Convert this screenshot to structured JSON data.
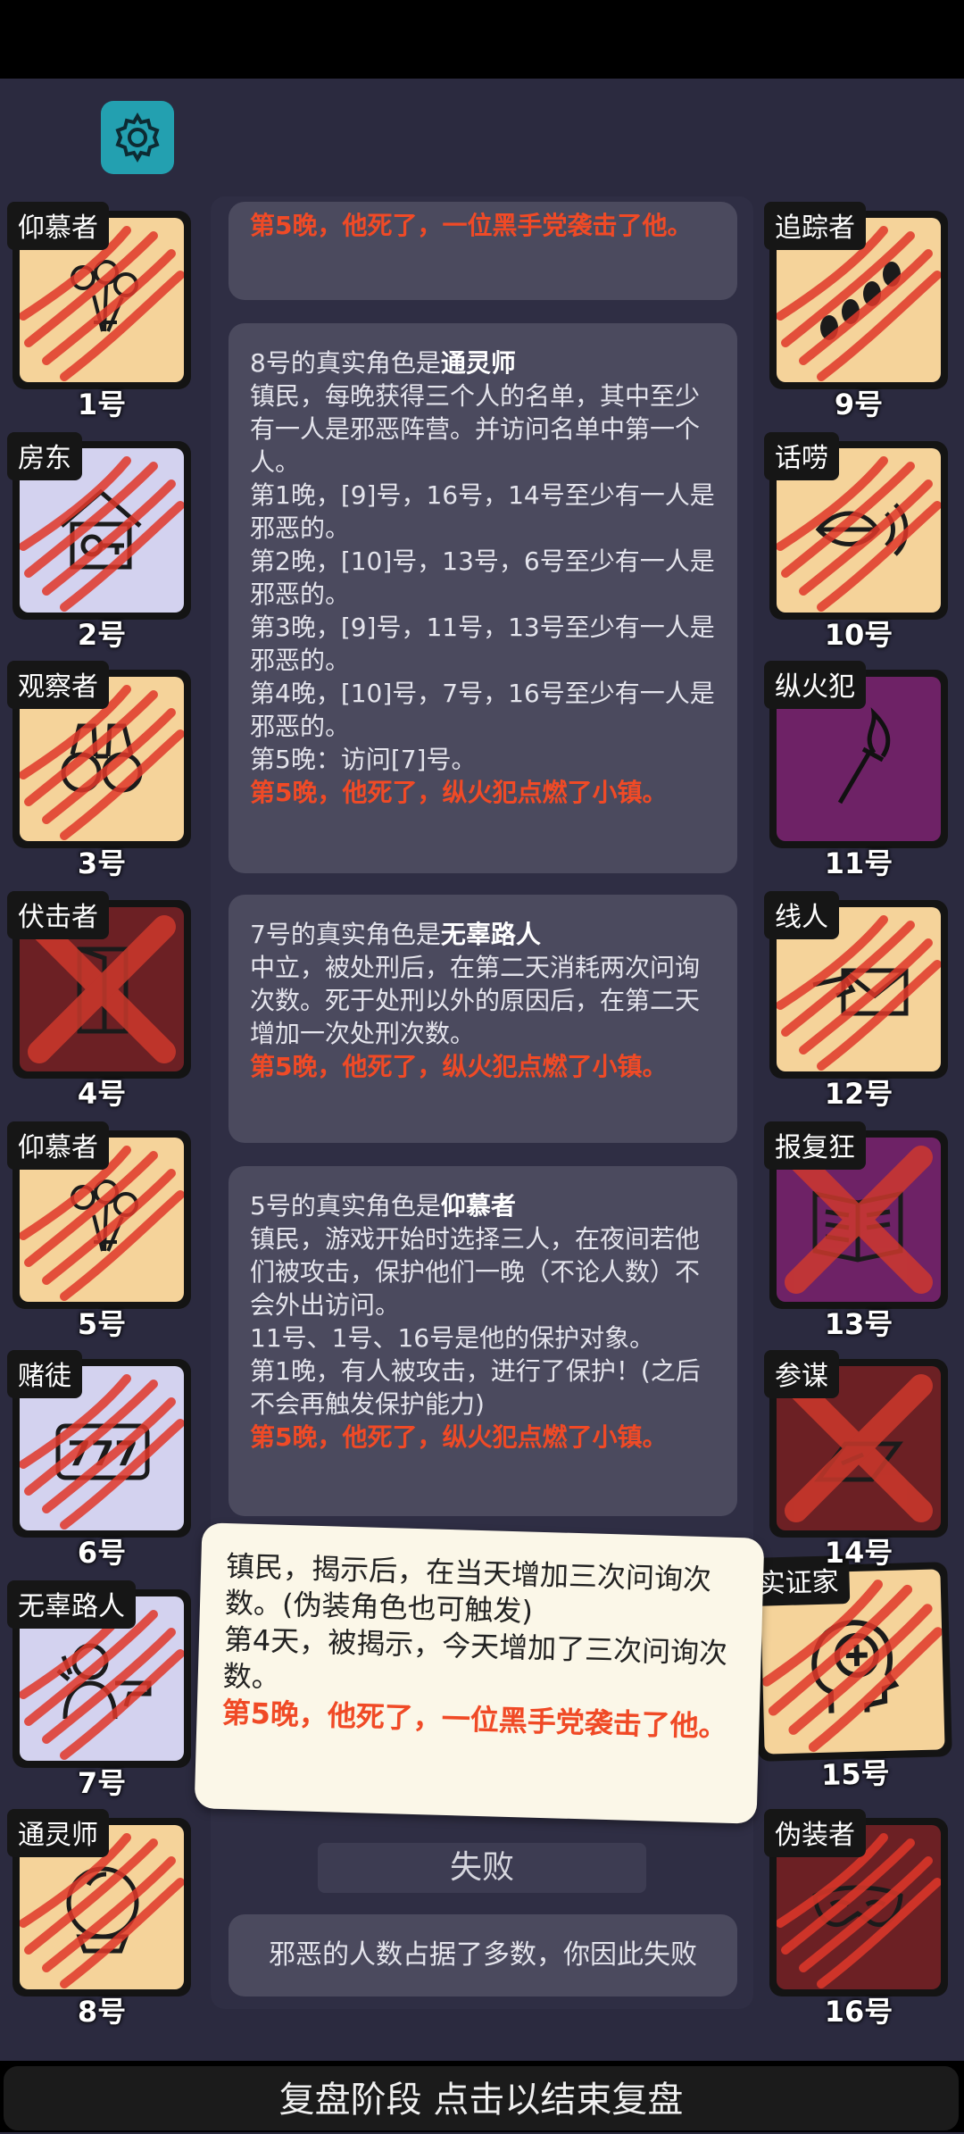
{
  "settings_icon": "gear-icon",
  "left_cards": [
    {
      "role": "仰慕者",
      "num": "1号",
      "bg": "peach",
      "icon": "flowers-icon",
      "mark": "claw"
    },
    {
      "role": "房东",
      "num": "2号",
      "bg": "lav",
      "icon": "house-key-icon",
      "mark": "claw"
    },
    {
      "role": "观察者",
      "num": "3号",
      "bg": "peach",
      "icon": "binoculars-icon",
      "mark": "claw"
    },
    {
      "role": "伏击者",
      "num": "4号",
      "bg": "maroon",
      "icon": "door-icon",
      "mark": "x"
    },
    {
      "role": "仰慕者",
      "num": "5号",
      "bg": "peach",
      "icon": "flowers-icon",
      "mark": "claw"
    },
    {
      "role": "赌徒",
      "num": "6号",
      "bg": "lav",
      "icon": "slot-777-icon",
      "mark": "claw"
    },
    {
      "role": "无辜路人",
      "num": "7号",
      "bg": "lav",
      "icon": "hostage-gun-icon",
      "mark": "claw"
    },
    {
      "role": "通灵师",
      "num": "8号",
      "bg": "peach",
      "icon": "crystal-ball-icon",
      "mark": "claw"
    }
  ],
  "right_cards": [
    {
      "role": "追踪者",
      "num": "9号",
      "bg": "peach",
      "icon": "footprints-icon",
      "mark": "claw"
    },
    {
      "role": "话唠",
      "num": "10号",
      "bg": "peach",
      "icon": "mouth-sound-icon",
      "mark": "claw"
    },
    {
      "role": "纵火犯",
      "num": "11号",
      "bg": "purple",
      "icon": "torch-icon",
      "mark": "none"
    },
    {
      "role": "线人",
      "num": "12号",
      "bg": "peach",
      "icon": "envelope-hand-icon",
      "mark": "claw"
    },
    {
      "role": "报复狂",
      "num": "13号",
      "bg": "purple",
      "icon": "book-icon",
      "mark": "x"
    },
    {
      "role": "参谋",
      "num": "14号",
      "bg": "maroon",
      "icon": "map-icon",
      "mark": "x"
    },
    {
      "role": "实证家",
      "num": "15号",
      "bg": "peach",
      "icon": "head-plus-icon",
      "mark": "claw"
    },
    {
      "role": "伪装者",
      "num": "16号",
      "bg": "maroon",
      "icon": "mask-icon",
      "mark": "claw"
    }
  ],
  "messages": {
    "top_partial": "第5晚，他死了，一位黑手党袭击了他。",
    "msg8": {
      "title_prefix": "8号的真实角色是",
      "title_role": "通灵师",
      "lines": [
        "镇民，每晚获得三个人的名单，其中至少有一人是邪恶阵营。并访问名单中第一个人。",
        "第1晚，[9]号，16号，14号至少有一人是邪恶的。",
        "第2晚，[10]号，13号，6号至少有一人是邪恶的。",
        "第3晚，[9]号，11号，13号至少有一人是邪恶的。",
        "第4晚，[10]号，7号，16号至少有一人是邪恶的。",
        "第5晚：访问[7]号。"
      ],
      "death": "第5晚，他死了，纵火犯点燃了小镇。"
    },
    "msg7": {
      "title_prefix": "7号的真实角色是",
      "title_role": "无辜路人",
      "lines": [
        "中立，被处刑后，在第二天消耗两次问询次数。死于处刑以外的原因后，在第二天增加一次处刑次数。"
      ],
      "death": "第5晚，他死了，纵火犯点燃了小镇。"
    },
    "msg5": {
      "title_prefix": "5号的真实角色是",
      "title_role": "仰慕者",
      "lines": [
        "镇民，游戏开始时选择三人，在夜间若他们被攻击，保护他们一晚（不论人数）不会外出访问。",
        "11号、1号、16号是他的保护对象。",
        "第1晚，有人被攻击，进行了保护！(之后不会再触发保护能力)"
      ],
      "death": "第5晚，他死了，纵火犯点燃了小镇。"
    }
  },
  "popup": {
    "lines": [
      "镇民，揭示后，在当天增加三次问询次数。(伪装角色也可触发)",
      "第4天，被揭示，今天增加了三次问询次数。"
    ],
    "death": "第5晚，他死了，一位黑手党袭击了他。"
  },
  "fail_label": "失败",
  "result_text": "邪恶的人数占据了多数，你因此失败",
  "end_button": "复盘阶段 点击以结束复盘"
}
